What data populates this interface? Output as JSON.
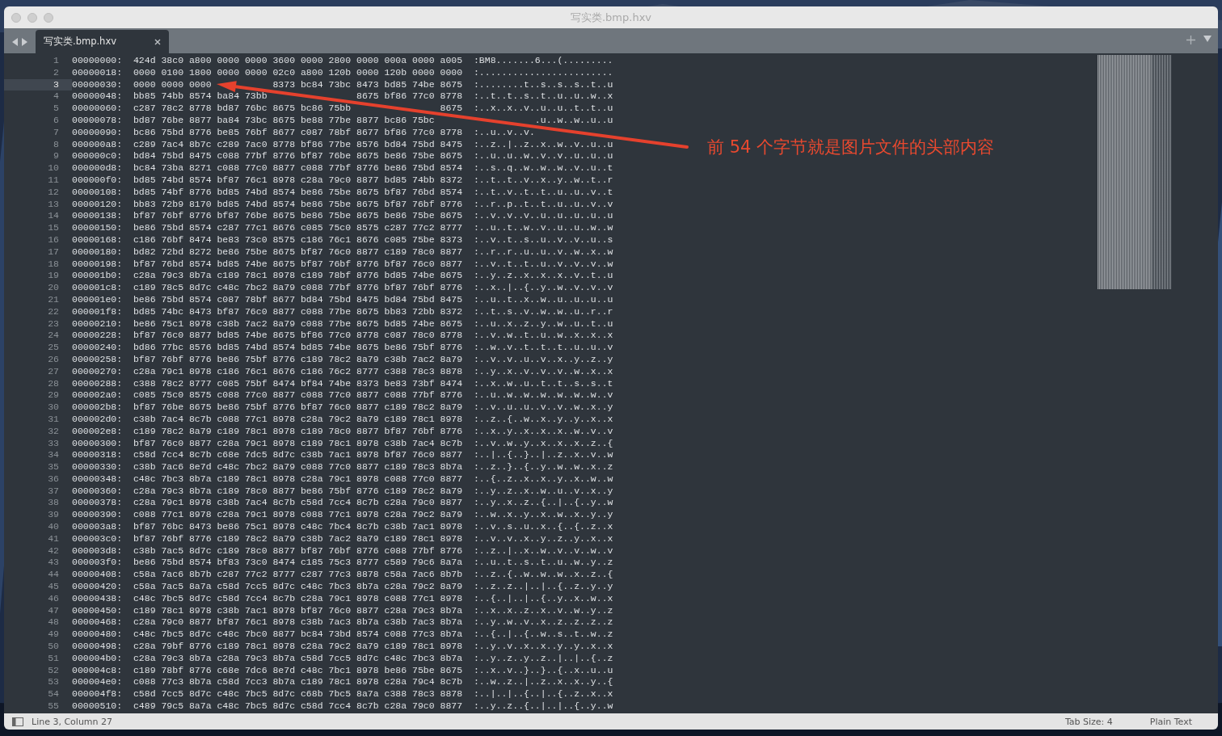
{
  "window": {
    "title": "写实类.bmp.hxv"
  },
  "tabs": [
    {
      "label": "写实类.bmp.hxv",
      "selected": true
    }
  ],
  "annotation": {
    "text": "前 54 个字节就是图片文件的头部内容"
  },
  "rows": [
    {
      "line": "1",
      "offset": "00000000:",
      "hex": [
        "424d",
        "38c0",
        "a800",
        "0000",
        "0000",
        "3600",
        "0000",
        "2800",
        "0000",
        "000a",
        "0000",
        "a005"
      ],
      "ascii": [
        ":BM8.......6...(........."
      ],
      "current": false
    },
    {
      "line": "2",
      "offset": "00000018:",
      "hex": [
        "0000",
        "0100",
        "1800",
        "0000",
        "0000",
        "02c0",
        "a800",
        "120b",
        "0000",
        "120b",
        "0000",
        "0000"
      ],
      "ascii": [
        ":........................"
      ],
      "current": false
    },
    {
      "line": "3",
      "offset": "00000030:",
      "hex": [
        "0000",
        "0000",
        "0000",
        {
          "kind": "covered"
        },
        {
          "kind": "covered"
        },
        "8373",
        "bc84",
        "73bc",
        "8473",
        "bd85",
        "74be",
        "8675"
      ],
      "ascii": [
        ":........t..s..s..s..t..u"
      ],
      "current": true
    },
    {
      "line": "4",
      "offset": "00000048:",
      "hex": [
        "bb85",
        "74bb",
        "8574",
        "ba84",
        "73bb",
        {
          "kind": "covered"
        },
        {
          "kind": "covered"
        },
        {
          "kind": "covered"
        },
        "8675",
        "bf86",
        "77c0",
        "8778"
      ],
      "ascii": [
        ":..t..t..s..t..u..u..w..x"
      ],
      "current": false
    },
    {
      "line": "5",
      "offset": "00000060:",
      "hex": [
        "c287",
        "78c2",
        "8778",
        "bd87",
        "76bc",
        "8675",
        "bc86",
        "75bb",
        {
          "kind": "covered"
        },
        {
          "kind": "covered"
        },
        {
          "kind": "covered"
        },
        "8675"
      ],
      "ascii": [
        ":..x..x..v..u..u..t..t..u"
      ],
      "current": false
    },
    {
      "line": "6",
      "offset": "00000078:",
      "hex": [
        "bd87",
        "76be",
        "8877",
        "ba84",
        "73bc",
        "8675",
        "be88",
        "77be",
        "8877",
        "bc86",
        "75bc",
        {
          "kind": "covered"
        }
      ],
      "ascii": [
        {
          "kind": "covered"
        },
        ".u..w..w..u..u"
      ],
      "current": false
    },
    {
      "line": "7",
      "offset": "00000090:",
      "hex": [
        "bc86",
        "75bd",
        "8776",
        "be85",
        "76bf",
        "8677",
        "c087",
        "78bf",
        "8677",
        "bf86",
        "77c0",
        "8778"
      ],
      "ascii": [
        ":..u..v..v."
      ],
      "current": false
    },
    {
      "line": "8",
      "offset": "000000a8:",
      "hex": [
        "c289",
        "7ac4",
        "8b7c",
        "c289",
        "7ac0",
        "8778",
        "bf86",
        "77be",
        "8576",
        "bd84",
        "75bd",
        "8475"
      ],
      "ascii": [
        ":..z..|..z..x..w..v..u..u"
      ],
      "current": false
    },
    {
      "line": "9",
      "offset": "000000c0:",
      "hex": [
        "bd84",
        "75bd",
        "8475",
        "c088",
        "77bf",
        "8776",
        "bf87",
        "76be",
        "8675",
        "be86",
        "75be",
        "8675"
      ],
      "ascii": [
        ":..u..u..w..v..v..u..u..u"
      ],
      "current": false
    },
    {
      "line": "10",
      "offset": "000000d8:",
      "hex": [
        "bc84",
        "73ba",
        "8271",
        "c088",
        "77c0",
        "8877",
        "c088",
        "77bf",
        "8776",
        "be86",
        "75bd",
        "8574"
      ],
      "ascii": [
        ":..s..q..w..w..w..v..u..t"
      ],
      "current": false
    },
    {
      "line": "11",
      "offset": "000000f0:",
      "hex": [
        "bd85",
        "74bd",
        "8574",
        "bf87",
        "76c1",
        "8978",
        "c28a",
        "79c0",
        "8877",
        "bd85",
        "74bb",
        "8372"
      ],
      "ascii": [
        ":..t..t..v..x..y..w..t..r"
      ],
      "current": false
    },
    {
      "line": "12",
      "offset": "00000108:",
      "hex": [
        "bd85",
        "74bf",
        "8776",
        "bd85",
        "74bd",
        "8574",
        "be86",
        "75be",
        "8675",
        "bf87",
        "76bd",
        "8574"
      ],
      "ascii": [
        ":..t..v..t..t..u..u..v..t"
      ],
      "current": false
    },
    {
      "line": "13",
      "offset": "00000120:",
      "hex": [
        "bb83",
        "72b9",
        "8170",
        "bd85",
        "74bd",
        "8574",
        "be86",
        "75be",
        "8675",
        "bf87",
        "76bf",
        "8776"
      ],
      "ascii": [
        ":..r..p..t..t..u..u..v..v"
      ],
      "current": false
    },
    {
      "line": "14",
      "offset": "00000138:",
      "hex": [
        "bf87",
        "76bf",
        "8776",
        "bf87",
        "76be",
        "8675",
        "be86",
        "75be",
        "8675",
        "be86",
        "75be",
        "8675"
      ],
      "ascii": [
        ":..v..v..v..u..u..u..u..u"
      ],
      "current": false
    },
    {
      "line": "15",
      "offset": "00000150:",
      "hex": [
        "be86",
        "75bd",
        "8574",
        "c287",
        "77c1",
        "8676",
        "c085",
        "75c0",
        "8575",
        "c287",
        "77c2",
        "8777"
      ],
      "ascii": [
        ":..u..t..w..v..u..u..w..w"
      ],
      "current": false
    },
    {
      "line": "16",
      "offset": "00000168:",
      "hex": [
        "c186",
        "76bf",
        "8474",
        "be83",
        "73c0",
        "8575",
        "c186",
        "76c1",
        "8676",
        "c085",
        "75be",
        "8373"
      ],
      "ascii": [
        ":..v..t..s..u..v..v..u..s"
      ],
      "current": false
    },
    {
      "line": "17",
      "offset": "00000180:",
      "hex": [
        "bd82",
        "72bd",
        "8272",
        "be86",
        "75be",
        "8675",
        "bf87",
        "76c0",
        "8877",
        "c189",
        "78c0",
        "8877"
      ],
      "ascii": [
        ":..r..r..u..u..v..w..x..w"
      ],
      "current": false
    },
    {
      "line": "18",
      "offset": "00000198:",
      "hex": [
        "bf87",
        "76bd",
        "8574",
        "bd85",
        "74be",
        "8675",
        "bf87",
        "76bf",
        "8776",
        "bf87",
        "76c0",
        "8877"
      ],
      "ascii": [
        ":..v..t..t..u..v..v..v..w"
      ],
      "current": false
    },
    {
      "line": "19",
      "offset": "000001b0:",
      "hex": [
        "c28a",
        "79c3",
        "8b7a",
        "c189",
        "78c1",
        "8978",
        "c189",
        "78bf",
        "8776",
        "bd85",
        "74be",
        "8675"
      ],
      "ascii": [
        ":..y..z..x..x..x..v..t..u"
      ],
      "current": false
    },
    {
      "line": "20",
      "offset": "000001c8:",
      "hex": [
        "c189",
        "78c5",
        "8d7c",
        "c48c",
        "7bc2",
        "8a79",
        "c088",
        "77bf",
        "8776",
        "bf87",
        "76bf",
        "8776"
      ],
      "ascii": [
        ":..x..|..{..y..w..v..v..v"
      ],
      "current": false
    },
    {
      "line": "21",
      "offset": "000001e0:",
      "hex": [
        "be86",
        "75bd",
        "8574",
        "c087",
        "78bf",
        "8677",
        "bd84",
        "75bd",
        "8475",
        "bd84",
        "75bd",
        "8475"
      ],
      "ascii": [
        ":..u..t..x..w..u..u..u..u"
      ],
      "current": false
    },
    {
      "line": "22",
      "offset": "000001f8:",
      "hex": [
        "bd85",
        "74bc",
        "8473",
        "bf87",
        "76c0",
        "8877",
        "c088",
        "77be",
        "8675",
        "bb83",
        "72bb",
        "8372"
      ],
      "ascii": [
        ":..t..s..v..w..w..u..r..r"
      ],
      "current": false
    },
    {
      "line": "23",
      "offset": "00000210:",
      "hex": [
        "be86",
        "75c1",
        "8978",
        "c38b",
        "7ac2",
        "8a79",
        "c088",
        "77be",
        "8675",
        "bd85",
        "74be",
        "8675"
      ],
      "ascii": [
        ":..u..x..z..y..w..u..t..u"
      ],
      "current": false
    },
    {
      "line": "24",
      "offset": "00000228:",
      "hex": [
        "bf87",
        "76c0",
        "8877",
        "bd85",
        "74be",
        "8675",
        "bf86",
        "77c0",
        "8778",
        "c087",
        "78c0",
        "8778"
      ],
      "ascii": [
        ":..v..w..t..u..w..x..x..x"
      ],
      "current": false
    },
    {
      "line": "25",
      "offset": "00000240:",
      "hex": [
        "bd86",
        "77bc",
        "8576",
        "bd85",
        "74bd",
        "8574",
        "bd85",
        "74be",
        "8675",
        "be86",
        "75bf",
        "8776"
      ],
      "ascii": [
        ":..w..v..t..t..t..u..u..v"
      ],
      "current": false
    },
    {
      "line": "26",
      "offset": "00000258:",
      "hex": [
        "bf87",
        "76bf",
        "8776",
        "be86",
        "75bf",
        "8776",
        "c189",
        "78c2",
        "8a79",
        "c38b",
        "7ac2",
        "8a79"
      ],
      "ascii": [
        ":..v..v..u..v..x..y..z..y"
      ],
      "current": false
    },
    {
      "line": "27",
      "offset": "00000270:",
      "hex": [
        "c28a",
        "79c1",
        "8978",
        "c186",
        "76c1",
        "8676",
        "c186",
        "76c2",
        "8777",
        "c388",
        "78c3",
        "8878"
      ],
      "ascii": [
        ":..y..x..v..v..v..w..x..x"
      ],
      "current": false
    },
    {
      "line": "28",
      "offset": "00000288:",
      "hex": [
        "c388",
        "78c2",
        "8777",
        "c085",
        "75bf",
        "8474",
        "bf84",
        "74be",
        "8373",
        "be83",
        "73bf",
        "8474"
      ],
      "ascii": [
        ":..x..w..u..t..t..s..s..t"
      ],
      "current": false
    },
    {
      "line": "29",
      "offset": "000002a0:",
      "hex": [
        "c085",
        "75c0",
        "8575",
        "c088",
        "77c0",
        "8877",
        "c088",
        "77c0",
        "8877",
        "c088",
        "77bf",
        "8776"
      ],
      "ascii": [
        ":..u..w..w..w..w..w..w..v"
      ],
      "current": false
    },
    {
      "line": "30",
      "offset": "000002b8:",
      "hex": [
        "bf87",
        "76be",
        "8675",
        "be86",
        "75bf",
        "8776",
        "bf87",
        "76c0",
        "8877",
        "c189",
        "78c2",
        "8a79"
      ],
      "ascii": [
        ":..v..u..u..v..v..w..x..y"
      ],
      "current": false
    },
    {
      "line": "31",
      "offset": "000002d0:",
      "hex": [
        "c38b",
        "7ac4",
        "8c7b",
        "c088",
        "77c1",
        "8978",
        "c28a",
        "79c2",
        "8a79",
        "c189",
        "78c1",
        "8978"
      ],
      "ascii": [
        ":..z..{..w..x..y..y..x..x"
      ],
      "current": false
    },
    {
      "line": "32",
      "offset": "000002e8:",
      "hex": [
        "c189",
        "78c2",
        "8a79",
        "c189",
        "78c1",
        "8978",
        "c189",
        "78c0",
        "8877",
        "bf87",
        "76bf",
        "8776"
      ],
      "ascii": [
        ":..x..y..x..x..x..w..v..v"
      ],
      "current": false
    },
    {
      "line": "33",
      "offset": "00000300:",
      "hex": [
        "bf87",
        "76c0",
        "8877",
        "c28a",
        "79c1",
        "8978",
        "c189",
        "78c1",
        "8978",
        "c38b",
        "7ac4",
        "8c7b"
      ],
      "ascii": [
        ":..v..w..y..x..x..x..z..{"
      ],
      "current": false
    },
    {
      "line": "34",
      "offset": "00000318:",
      "hex": [
        "c58d",
        "7cc4",
        "8c7b",
        "c68e",
        "7dc5",
        "8d7c",
        "c38b",
        "7ac1",
        "8978",
        "bf87",
        "76c0",
        "8877"
      ],
      "ascii": [
        ":..|..{..}..|..z..x..v..w"
      ],
      "current": false
    },
    {
      "line": "35",
      "offset": "00000330:",
      "hex": [
        "c38b",
        "7ac6",
        "8e7d",
        "c48c",
        "7bc2",
        "8a79",
        "c088",
        "77c0",
        "8877",
        "c189",
        "78c3",
        "8b7a"
      ],
      "ascii": [
        ":..z..}..{..y..w..w..x..z"
      ],
      "current": false
    },
    {
      "line": "36",
      "offset": "00000348:",
      "hex": [
        "c48c",
        "7bc3",
        "8b7a",
        "c189",
        "78c1",
        "8978",
        "c28a",
        "79c1",
        "8978",
        "c088",
        "77c0",
        "8877"
      ],
      "ascii": [
        ":..{..z..x..x..y..x..w..w"
      ],
      "current": false
    },
    {
      "line": "37",
      "offset": "00000360:",
      "hex": [
        "c28a",
        "79c3",
        "8b7a",
        "c189",
        "78c0",
        "8877",
        "be86",
        "75bf",
        "8776",
        "c189",
        "78c2",
        "8a79"
      ],
      "ascii": [
        ":..y..z..x..w..u..v..x..y"
      ],
      "current": false
    },
    {
      "line": "38",
      "offset": "00000378:",
      "hex": [
        "c28a",
        "79c1",
        "8978",
        "c38b",
        "7ac4",
        "8c7b",
        "c58d",
        "7cc4",
        "8c7b",
        "c28a",
        "79c0",
        "8877"
      ],
      "ascii": [
        ":..y..x..z..{..|..{..y..w"
      ],
      "current": false
    },
    {
      "line": "39",
      "offset": "00000390:",
      "hex": [
        "c088",
        "77c1",
        "8978",
        "c28a",
        "79c1",
        "8978",
        "c088",
        "77c1",
        "8978",
        "c28a",
        "79c2",
        "8a79"
      ],
      "ascii": [
        ":..w..x..y..x..w..x..y..y"
      ],
      "current": false
    },
    {
      "line": "40",
      "offset": "000003a8:",
      "hex": [
        "bf87",
        "76bc",
        "8473",
        "be86",
        "75c1",
        "8978",
        "c48c",
        "7bc4",
        "8c7b",
        "c38b",
        "7ac1",
        "8978"
      ],
      "ascii": [
        ":..v..s..u..x..{..{..z..x"
      ],
      "current": false
    },
    {
      "line": "41",
      "offset": "000003c0:",
      "hex": [
        "bf87",
        "76bf",
        "8776",
        "c189",
        "78c2",
        "8a79",
        "c38b",
        "7ac2",
        "8a79",
        "c189",
        "78c1",
        "8978"
      ],
      "ascii": [
        ":..v..v..x..y..z..y..x..x"
      ],
      "current": false
    },
    {
      "line": "42",
      "offset": "000003d8:",
      "hex": [
        "c38b",
        "7ac5",
        "8d7c",
        "c189",
        "78c0",
        "8877",
        "bf87",
        "76bf",
        "8776",
        "c088",
        "77bf",
        "8776"
      ],
      "ascii": [
        ":..z..|..x..w..v..v..w..v"
      ],
      "current": false
    },
    {
      "line": "43",
      "offset": "000003f0:",
      "hex": [
        "be86",
        "75bd",
        "8574",
        "bf83",
        "73c0",
        "8474",
        "c185",
        "75c3",
        "8777",
        "c589",
        "79c6",
        "8a7a"
      ],
      "ascii": [
        ":..u..t..s..t..u..w..y..z"
      ],
      "current": false
    },
    {
      "line": "44",
      "offset": "00000408:",
      "hex": [
        "c58a",
        "7ac6",
        "8b7b",
        "c287",
        "77c2",
        "8777",
        "c287",
        "77c3",
        "8878",
        "c58a",
        "7ac6",
        "8b7b"
      ],
      "ascii": [
        ":..z..{..w..w..w..x..z..{"
      ],
      "current": false
    },
    {
      "line": "45",
      "offset": "00000420:",
      "hex": [
        "c58a",
        "7ac5",
        "8a7a",
        "c58d",
        "7cc5",
        "8d7c",
        "c48c",
        "7bc3",
        "8b7a",
        "c28a",
        "79c2",
        "8a79"
      ],
      "ascii": [
        ":..z..z..|..|..{..z..y..y"
      ],
      "current": false
    },
    {
      "line": "46",
      "offset": "00000438:",
      "hex": [
        "c48c",
        "7bc5",
        "8d7c",
        "c58d",
        "7cc4",
        "8c7b",
        "c28a",
        "79c1",
        "8978",
        "c088",
        "77c1",
        "8978"
      ],
      "ascii": [
        ":..{..|..|..{..y..x..w..x"
      ],
      "current": false
    },
    {
      "line": "47",
      "offset": "00000450:",
      "hex": [
        "c189",
        "78c1",
        "8978",
        "c38b",
        "7ac1",
        "8978",
        "bf87",
        "76c0",
        "8877",
        "c28a",
        "79c3",
        "8b7a"
      ],
      "ascii": [
        ":..x..x..z..x..v..w..y..z"
      ],
      "current": false
    },
    {
      "line": "48",
      "offset": "00000468:",
      "hex": [
        "c28a",
        "79c0",
        "8877",
        "bf87",
        "76c1",
        "8978",
        "c38b",
        "7ac3",
        "8b7a",
        "c38b",
        "7ac3",
        "8b7a"
      ],
      "ascii": [
        ":..y..w..v..x..z..z..z..z"
      ],
      "current": false
    },
    {
      "line": "49",
      "offset": "00000480:",
      "hex": [
        "c48c",
        "7bc5",
        "8d7c",
        "c48c",
        "7bc0",
        "8877",
        "bc84",
        "73bd",
        "8574",
        "c088",
        "77c3",
        "8b7a"
      ],
      "ascii": [
        ":..{..|..{..w..s..t..w..z"
      ],
      "current": false
    },
    {
      "line": "50",
      "offset": "00000498:",
      "hex": [
        "c28a",
        "79bf",
        "8776",
        "c189",
        "78c1",
        "8978",
        "c28a",
        "79c2",
        "8a79",
        "c189",
        "78c1",
        "8978"
      ],
      "ascii": [
        ":..y..v..x..x..y..y..x..x"
      ],
      "current": false
    },
    {
      "line": "51",
      "offset": "000004b0:",
      "hex": [
        "c28a",
        "79c3",
        "8b7a",
        "c28a",
        "79c3",
        "8b7a",
        "c58d",
        "7cc5",
        "8d7c",
        "c48c",
        "7bc3",
        "8b7a"
      ],
      "ascii": [
        ":..y..z..y..z..|..|..{..z"
      ],
      "current": false
    },
    {
      "line": "52",
      "offset": "000004c8:",
      "hex": [
        "c189",
        "78bf",
        "8776",
        "c68e",
        "7dc6",
        "8e7d",
        "c48c",
        "7bc1",
        "8978",
        "be86",
        "75be",
        "8675"
      ],
      "ascii": [
        ":..x..v..}..}..{..x..u..u"
      ],
      "current": false
    },
    {
      "line": "53",
      "offset": "000004e0:",
      "hex": [
        "c088",
        "77c3",
        "8b7a",
        "c58d",
        "7cc3",
        "8b7a",
        "c189",
        "78c1",
        "8978",
        "c28a",
        "79c4",
        "8c7b"
      ],
      "ascii": [
        ":..w..z..|..z..x..x..y..{"
      ],
      "current": false
    },
    {
      "line": "54",
      "offset": "000004f8:",
      "hex": [
        "c58d",
        "7cc5",
        "8d7c",
        "c48c",
        "7bc5",
        "8d7c",
        "c68b",
        "7bc5",
        "8a7a",
        "c388",
        "78c3",
        "8878"
      ],
      "ascii": [
        ":..|..|..{..|..{..z..x..x"
      ],
      "current": false
    },
    {
      "line": "55",
      "offset": "00000510:",
      "hex": [
        "c489",
        "79c5",
        "8a7a",
        "c48c",
        "7bc5",
        "8d7c",
        "c58d",
        "7cc4",
        "8c7b",
        "c28a",
        "79c0",
        "8877"
      ],
      "ascii": [
        ":..y..z..{..|..|..{..y..w"
      ],
      "current": false
    }
  ],
  "status_bar": {
    "position": "Line 3, Column 27",
    "tab_size": "Tab Size: 4",
    "syntax": "Plain Text"
  }
}
